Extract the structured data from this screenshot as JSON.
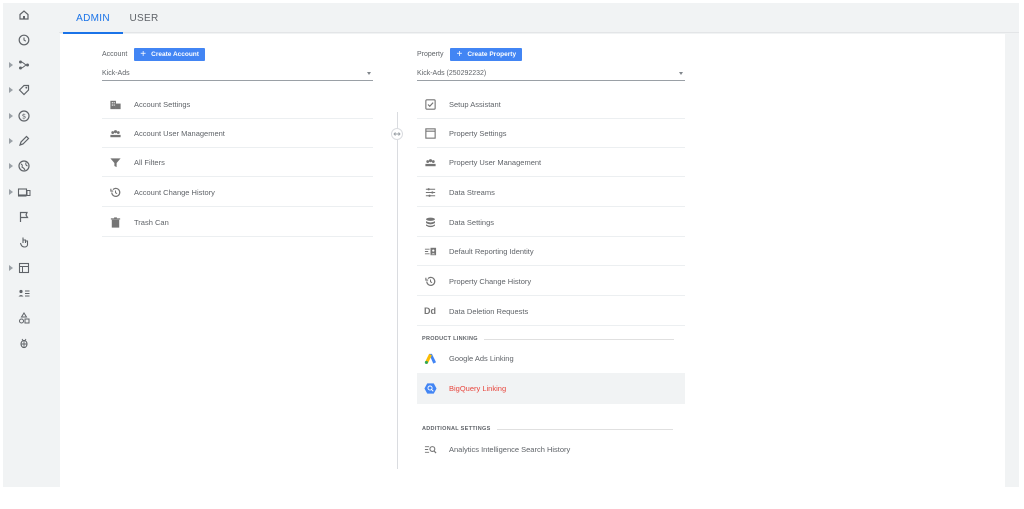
{
  "tabs": [
    {
      "label": "ADMIN",
      "active": true
    },
    {
      "label": "USER",
      "active": false
    }
  ],
  "rail": [
    {
      "icon": "home-icon",
      "expandable": false
    },
    {
      "icon": "clock-icon",
      "expandable": false
    },
    {
      "icon": "customization-icon",
      "expandable": true
    },
    {
      "icon": "tag-icon",
      "expandable": true
    },
    {
      "icon": "dollar-icon",
      "expandable": true
    },
    {
      "icon": "pen-icon",
      "expandable": true
    },
    {
      "icon": "globe-icon",
      "expandable": true
    },
    {
      "icon": "devices-icon",
      "expandable": true
    },
    {
      "icon": "flag-icon",
      "expandable": false
    },
    {
      "icon": "touch-icon",
      "expandable": false
    },
    {
      "icon": "report-icon",
      "expandable": true
    },
    {
      "icon": "user-list-icon",
      "expandable": false
    },
    {
      "icon": "shapes-icon",
      "expandable": false
    },
    {
      "icon": "bug-icon",
      "expandable": false
    }
  ],
  "account": {
    "label": "Account",
    "create_label": "Create Account",
    "selected": "Kick-Ads",
    "items": [
      {
        "label": "Account Settings",
        "icon": "building-icon"
      },
      {
        "label": "Account User Management",
        "icon": "users-icon"
      },
      {
        "label": "All Filters",
        "icon": "filter-icon"
      },
      {
        "label": "Account Change History",
        "icon": "history-icon"
      },
      {
        "label": "Trash Can",
        "icon": "trash-icon"
      }
    ]
  },
  "property": {
    "label": "Property",
    "create_label": "Create Property",
    "selected": "Kick-Ads (250292232)",
    "items": [
      {
        "label": "Setup Assistant",
        "icon": "checkbox-icon"
      },
      {
        "label": "Property Settings",
        "icon": "window-icon"
      },
      {
        "label": "Property User Management",
        "icon": "users-icon"
      },
      {
        "label": "Data Streams",
        "icon": "streams-icon"
      },
      {
        "label": "Data Settings",
        "icon": "database-icon"
      },
      {
        "label": "Default Reporting Identity",
        "icon": "identity-icon"
      },
      {
        "label": "Property Change History",
        "icon": "history-icon"
      },
      {
        "label": "Data Deletion Requests",
        "icon": "dd-icon",
        "glyph": "Dd"
      }
    ],
    "product_linking": {
      "title": "PRODUCT LINKING",
      "items": [
        {
          "label": "Google Ads Linking",
          "icon": "google-ads-icon"
        },
        {
          "label": "BigQuery Linking",
          "icon": "bigquery-icon"
        }
      ]
    },
    "additional_settings": {
      "title": "ADDITIONAL SETTINGS",
      "items": [
        {
          "label": "Analytics Intelligence Search History",
          "icon": "search-history-icon"
        }
      ]
    }
  },
  "colors": {
    "accent": "#1a73e8",
    "button": "#4285f4",
    "highlight_text": "#e8453c",
    "icon_gray": "#757575"
  }
}
